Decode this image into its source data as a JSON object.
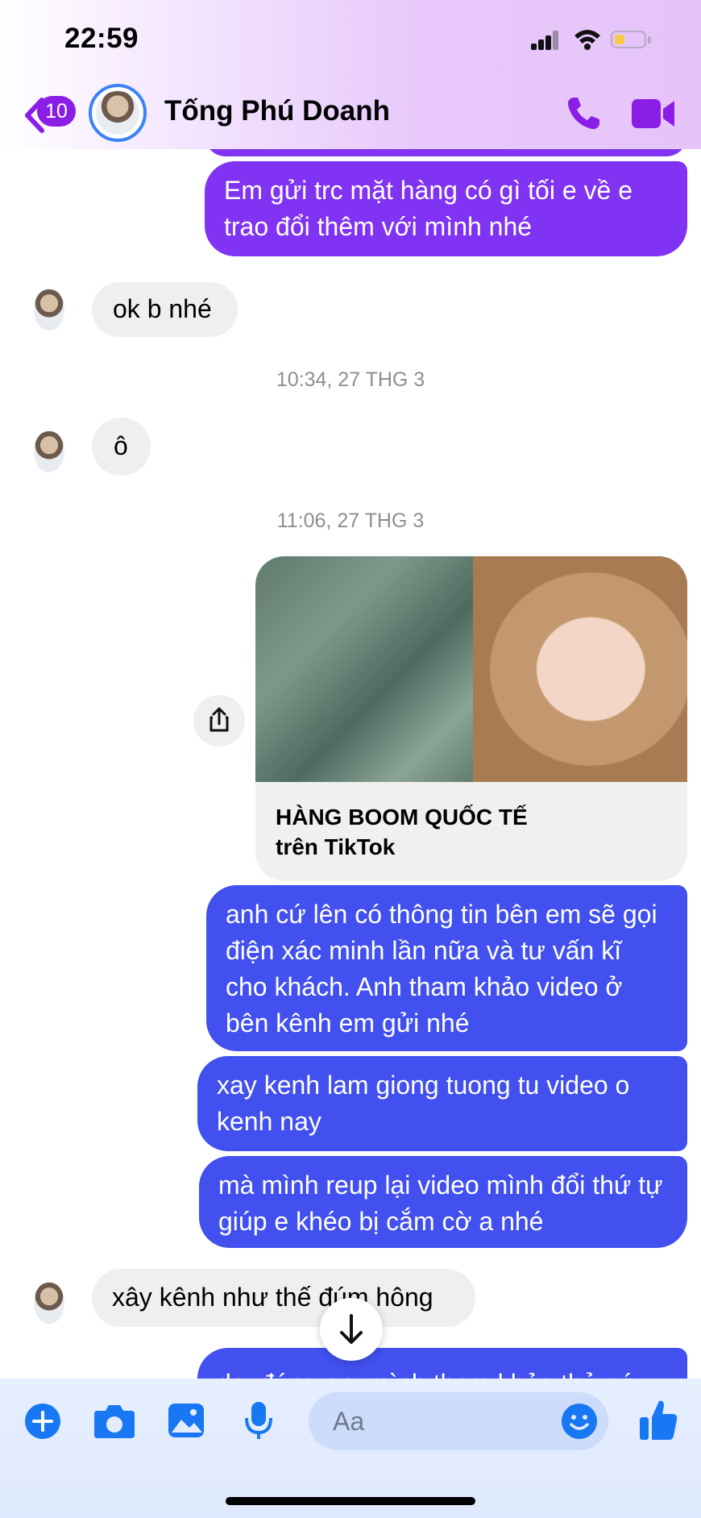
{
  "status_bar": {
    "time": "22:59"
  },
  "header": {
    "back_badge": "10",
    "contact_name": "Tống Phú Doanh"
  },
  "messages": [
    {
      "direction": "outgoing",
      "text": "Em gửi trc mặt hàng có gì tối e về e trao đổi thêm với mình nhé"
    },
    {
      "direction": "incoming",
      "text": "ok b nhé"
    },
    {
      "direction": "timestamp",
      "text": "10:34, 27 THG 3"
    },
    {
      "direction": "incoming",
      "text": "ô"
    },
    {
      "direction": "timestamp",
      "text": "11:06, 27 THG 3"
    },
    {
      "direction": "outgoing_link",
      "title": "HÀNG BOOM QUỐC TẾ",
      "subtitle": "trên TikTok"
    },
    {
      "direction": "outgoing",
      "text": "anh cứ lên có thông tin bên em sẽ gọi điện xác minh lần nữa và tư vấn kĩ cho khách. Anh tham khảo video ở bên kênh em gửi nhé"
    },
    {
      "direction": "outgoing",
      "text": "xay kenh lam giong tuong tu video o kenh nay"
    },
    {
      "direction": "outgoing",
      "text": "mà mình reup lại video mình đổi thứ tự giúp e khéo bị cắm cờ a nhé"
    },
    {
      "direction": "incoming",
      "text": "xây kênh như thế đúm hông"
    },
    {
      "direction": "outgoing",
      "text": "dạ, đúng r a, mình tham khảo thử có"
    }
  ],
  "composer": {
    "placeholder": "Aa"
  },
  "colors": {
    "outgoing_purple": "#8033f2",
    "outgoing_blue": "#4150ee",
    "incoming": "#efefef",
    "accent": "#8a1ee6",
    "composer_icon": "#1877f2"
  }
}
